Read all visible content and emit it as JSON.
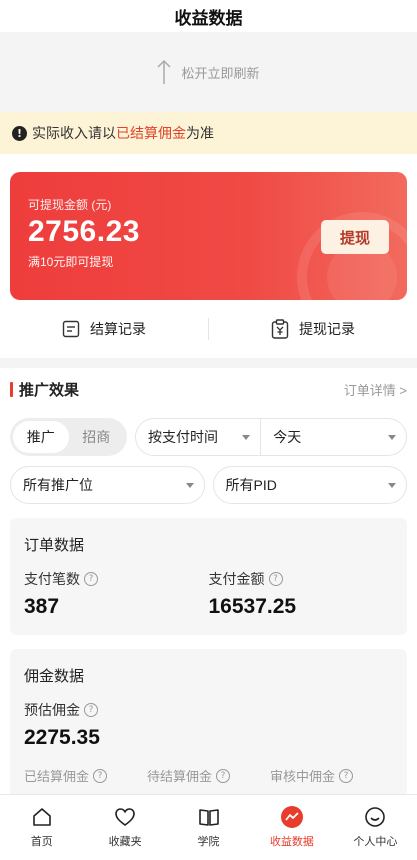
{
  "header": {
    "title": "收益数据"
  },
  "refresh": {
    "text": "松开立即刷新"
  },
  "notice": {
    "before": "实际收入请以",
    "highlight": "已结算佣金",
    "after": "为准",
    "icon": "exclamation-icon"
  },
  "balance": {
    "caption": "可提现金额 (元)",
    "amount": "2756.23",
    "note": "满10元即可提现",
    "withdraw_label": "提现",
    "colors": {
      "from": "#ee3d3c",
      "to": "#f26a5d"
    }
  },
  "records": {
    "settlement_label": "结算记录",
    "withdraw_label": "提现记录"
  },
  "promo": {
    "title": "推广效果",
    "detail_link": "订单详情 >",
    "segments": [
      "推广",
      "招商"
    ],
    "active_segment": 0,
    "time_filter": "按支付时间",
    "date_filter": "今天",
    "position_filter": "所有推广位",
    "pid_filter": "所有PID"
  },
  "orders": {
    "title": "订单数据",
    "count_label": "支付笔数",
    "count_value": "387",
    "amount_label": "支付金额",
    "amount_value": "16537.25"
  },
  "commission": {
    "title": "佣金数据",
    "est_label": "预估佣金",
    "est_value": "2275.35",
    "settled_label": "已结算佣金",
    "pending_label": "待结算佣金",
    "review_label": "审核中佣金"
  },
  "tabbar": {
    "items": [
      {
        "label": "首页",
        "icon": "home-icon"
      },
      {
        "label": "收藏夹",
        "icon": "heart-icon"
      },
      {
        "label": "学院",
        "icon": "book-icon"
      },
      {
        "label": "收益数据",
        "icon": "chart-icon"
      },
      {
        "label": "个人中心",
        "icon": "smile-icon"
      }
    ],
    "active": 3,
    "accent": "#e83c2c"
  }
}
